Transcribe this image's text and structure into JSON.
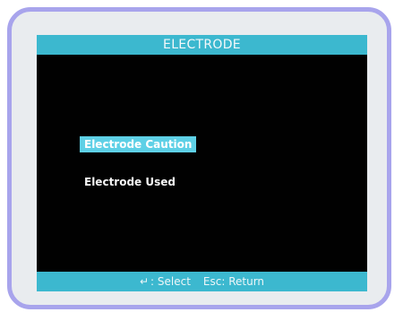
{
  "title": "ELECTRODE",
  "menu": {
    "items": [
      {
        "label": "Electrode Caution",
        "selected": true
      },
      {
        "label": "Electrode Used",
        "selected": false
      }
    ]
  },
  "footer": {
    "enter_icon": "enter-key-icon",
    "select_label": ": Select",
    "esc_label": "Esc: Return"
  },
  "colors": {
    "bar": "#3cb8cf",
    "highlight": "#5ed0e6",
    "screen_bg": "#010101",
    "bezel_border": "#a8a4ec"
  }
}
